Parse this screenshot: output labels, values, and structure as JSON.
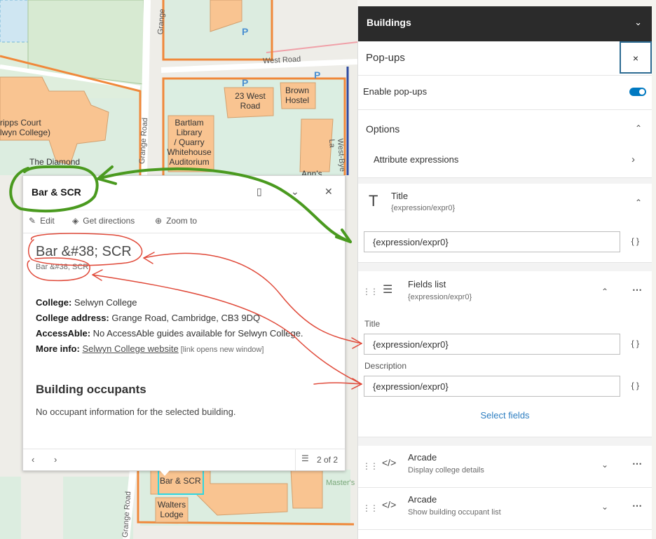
{
  "map": {
    "labels": {
      "scripps": "ripps Court\nlwyn College)",
      "diamond": "The Diamond",
      "west23": "23 West\nRoad",
      "brown": "Brown\nHostel",
      "bartlam": "Bartlam\nLibrary\n/ Quarry\nWhitehouse\nAuditorium",
      "anns": "Ann's",
      "barscr": "Bar & SCR",
      "walters": "Walters\nLodge",
      "masters": "Master's"
    },
    "roads": {
      "west_road": "West Road",
      "grange_road": "Grange Road",
      "grange": "Grange",
      "westbye": "West-Bye La"
    }
  },
  "popup": {
    "title": "Bar & SCR",
    "actions": {
      "edit": "Edit",
      "directions": "Get directions",
      "zoom": "Zoom to"
    },
    "heading": "Bar &#38; SCR",
    "subheading": "Bar &#38; SCR",
    "info": {
      "college_label": "College:",
      "college_value": " Selwyn College",
      "address_label": "College address:",
      "address_value": " Grange Road, Cambridge, CB3 9DQ",
      "access_label": "AccessAble:",
      "access_value": " No AccessAble guides available for Selwyn College.",
      "more_label": "More info:",
      "more_link": "Selwyn College website",
      "more_note": " [link opens new window]"
    },
    "occupants_heading": "Building occupants",
    "occupants_text": "No occupant information for the selected building.",
    "pager": "2 of 2"
  },
  "panel": {
    "header": "Buildings",
    "popups_title": "Pop-ups",
    "close": "×",
    "enable_label": "Enable pop-ups",
    "enable_on": true,
    "options_label": "Options",
    "attr_expr": "Attribute expressions",
    "title_section": {
      "label": "Title",
      "sub": "{expression/expr0}",
      "value": "{expression/expr0}",
      "braces": "{ }"
    },
    "fields_section": {
      "label": "Fields list",
      "sub": "{expression/expr0}",
      "title_label": "Title",
      "title_value": "{expression/expr0}",
      "desc_label": "Description",
      "desc_value": "{expression/expr0}",
      "braces": "{ }",
      "select_fields": "Select fields"
    },
    "arcade": [
      {
        "label": "Arcade",
        "sub": "Display college details"
      },
      {
        "label": "Arcade",
        "sub": "Show building occupant list"
      }
    ]
  },
  "colors": {
    "accent": "#0079c1",
    "header_bg": "#2b2b2b",
    "annotation_green": "#4a9a1f",
    "annotation_red": "#e04a3a",
    "building": "#f9c491",
    "boundary": "#f0883a"
  }
}
